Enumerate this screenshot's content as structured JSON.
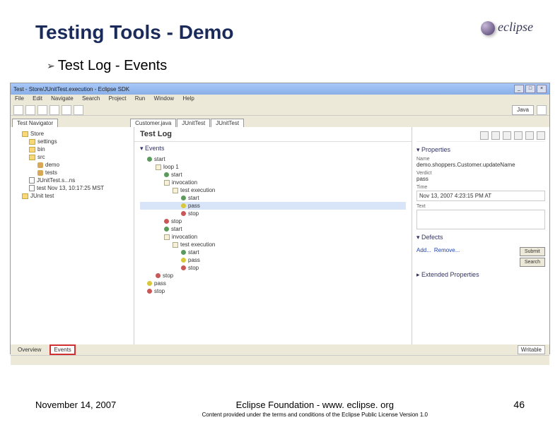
{
  "title": "Testing Tools - Demo",
  "logo_text": "eclipse",
  "bullet": "Test Log - Events",
  "window": {
    "title": "Test - Store/JUnitTest.execution - Eclipse SDK",
    "menus": [
      "File",
      "Edit",
      "Navigate",
      "Search",
      "Project",
      "Run",
      "Window",
      "Help"
    ],
    "perspective_java": "Java",
    "open_tabs": [
      "Test Navigator",
      "Customer.java",
      "JUnitTest",
      "JUnitTest"
    ],
    "testlog_title": "Test Log",
    "events_title": "▾ Events",
    "events": [
      {
        "cls": "",
        "kind": "green",
        "text": "start"
      },
      {
        "cls": "d1",
        "kind": "box",
        "text": "loop 1"
      },
      {
        "cls": "d2",
        "kind": "green",
        "text": "start"
      },
      {
        "cls": "d2",
        "kind": "box",
        "text": "invocation"
      },
      {
        "cls": "d3",
        "kind": "box",
        "text": "test execution"
      },
      {
        "cls": "d4",
        "kind": "green",
        "text": "start"
      },
      {
        "cls": "d4 sel",
        "kind": "yellow",
        "text": "pass"
      },
      {
        "cls": "d4",
        "kind": "red",
        "text": "stop"
      },
      {
        "cls": "d2",
        "kind": "red",
        "text": "stop"
      },
      {
        "cls": "d2",
        "kind": "green",
        "text": "start"
      },
      {
        "cls": "d2",
        "kind": "box",
        "text": "invocation"
      },
      {
        "cls": "d3",
        "kind": "box",
        "text": "test execution"
      },
      {
        "cls": "d4",
        "kind": "green",
        "text": "start"
      },
      {
        "cls": "d4",
        "kind": "yellow",
        "text": "pass"
      },
      {
        "cls": "d4",
        "kind": "red",
        "text": "stop"
      },
      {
        "cls": "d1",
        "kind": "red",
        "text": "stop"
      },
      {
        "cls": "",
        "kind": "yellow",
        "text": "pass"
      },
      {
        "cls": "",
        "kind": "red",
        "text": "stop"
      }
    ],
    "nav_tree": [
      {
        "cls": "",
        "icon": "folder",
        "text": "Store"
      },
      {
        "cls": "d1",
        "icon": "folder",
        "text": "settings"
      },
      {
        "cls": "d1",
        "icon": "folder",
        "text": "bin"
      },
      {
        "cls": "d1",
        "icon": "folder",
        "text": "src"
      },
      {
        "cls": "d2",
        "icon": "pkg",
        "text": "demo"
      },
      {
        "cls": "d2",
        "icon": "pkg",
        "text": "tests"
      },
      {
        "cls": "d1",
        "icon": "file",
        "text": "JUnitTest.s...ns"
      },
      {
        "cls": "d1",
        "icon": "file",
        "text": "test Nov 13, 10:17:25 MST"
      },
      {
        "cls": "",
        "icon": "folder",
        "text": "JUnit test"
      }
    ],
    "props": {
      "title1": "▾ Properties",
      "name_label": "Name",
      "name_value": "demo.shoppers.Customer.updateName",
      "verdict_label": "Verdict",
      "verdict_value": "pass",
      "time_label": "Time",
      "time_value": "Nov 13, 2007 4:23:15 PM AT",
      "text_label": "Text",
      "defects_title": "▾ Defects",
      "add_btn": "Add...",
      "remove_btn": "Remove...",
      "submit_btn": "Submit",
      "search_btn": "Search",
      "extprops_title": "▸ Extended Properties"
    },
    "bottom_tabs": {
      "overview": "Overview",
      "events": "Events",
      "writable": "Writable"
    }
  },
  "footer": {
    "date": "November 14, 2007",
    "center": "Eclipse Foundation - www. eclipse. org",
    "sub": "Content provided under the terms and conditions of the Eclipse Public License Version 1.0",
    "page": "46"
  }
}
